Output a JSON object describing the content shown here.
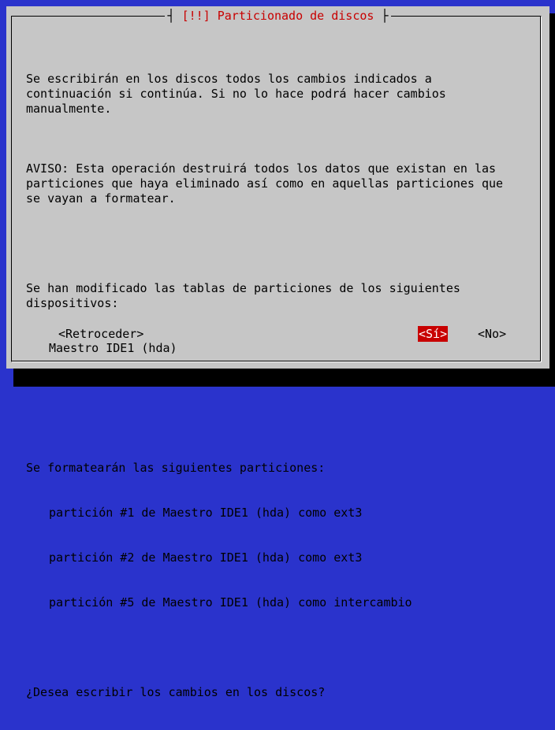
{
  "dialog": {
    "title": "[!!] Particionado de discos",
    "paragraphs": {
      "p1": "Se escribirán en los discos todos los cambios indicados a\ncontinuación si continúa. Si no lo hace podrá hacer cambios\nmanualmente.",
      "p2": "AVISO: Esta operación destruirá todos los datos que existan en las\nparticiones que haya eliminado así como en aquellas particiones que\nse vayan a formatear.",
      "p3_intro": "Se han modificado las tablas de particiones de los siguientes\ndispositivos:",
      "p3_devices": [
        "Maestro IDE1 (hda)"
      ],
      "p4_intro": "Se formatearán las siguientes particiones:",
      "p4_partitions": [
        "partición #1 de Maestro IDE1 (hda) como ext3",
        "partición #2 de Maestro IDE1 (hda) como ext3",
        "partición #5 de Maestro IDE1 (hda) como intercambio"
      ],
      "question": "¿Desea escribir los cambios en los discos?"
    },
    "buttons": {
      "back": "<Retroceder>",
      "yes": "<Sí>",
      "no": "<No>"
    }
  },
  "colors": {
    "background": "#2a33cc",
    "dialog": "#c6c6c6",
    "title": "#c80000",
    "selected_button": "#c80000"
  }
}
